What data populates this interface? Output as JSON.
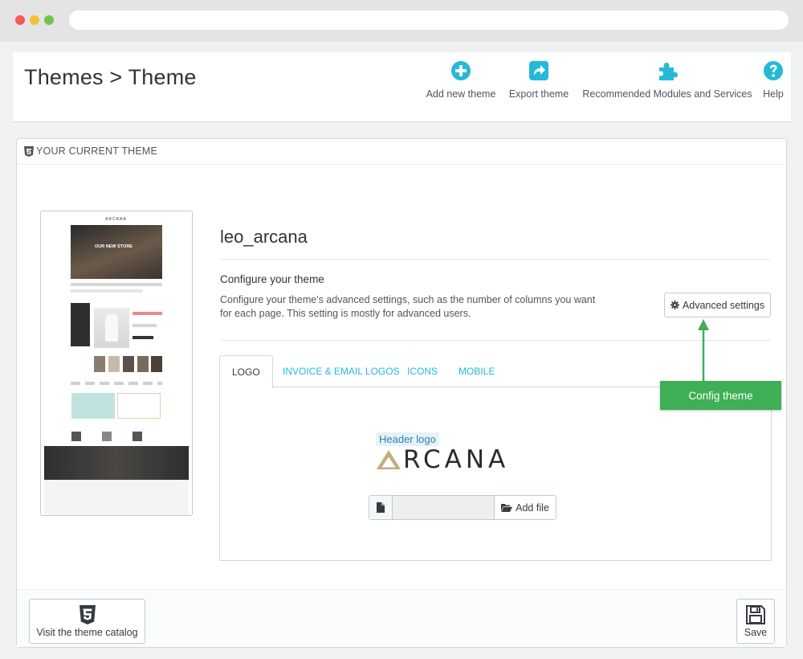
{
  "header": {
    "title": "Themes > Theme",
    "toolbar": [
      {
        "label": "Add new theme",
        "icon": "add-circle-icon"
      },
      {
        "label": "Export theme",
        "icon": "export-share-icon"
      },
      {
        "label": "Recommended Modules and Services",
        "icon": "puzzle-icon"
      },
      {
        "label": "Help",
        "icon": "help-circle-icon"
      }
    ]
  },
  "panel": {
    "heading": "YOUR CURRENT THEME",
    "theme_name": "leo_arcana",
    "configure": {
      "title": "Configure your theme",
      "description": "Configure your theme's advanced settings, such as the number of columns you want for each page. This setting is mostly for advanced users.",
      "advanced_button": "Advanced settings"
    },
    "tabs": [
      {
        "label": "LOGO",
        "active": true
      },
      {
        "label": "INVOICE & EMAIL LOGOS",
        "active": false
      },
      {
        "label": "ICONS",
        "active": false
      },
      {
        "label": "MOBILE",
        "active": false
      }
    ],
    "logo_tab": {
      "header_logo_label": "Header logo",
      "logo_word": "RCANA",
      "add_file_label": "Add file"
    },
    "preview": {
      "logo": "ARCANA",
      "hero_text": "OUR NEW STORE"
    }
  },
  "footer": {
    "catalog_button": "Visit the theme catalog",
    "save_button": "Save"
  },
  "annotation": {
    "callout_text": "Config theme"
  },
  "colors": {
    "accent": "#25b9d7",
    "callout_green": "#3eaf55",
    "logo_gold": "#c4ad7c"
  }
}
